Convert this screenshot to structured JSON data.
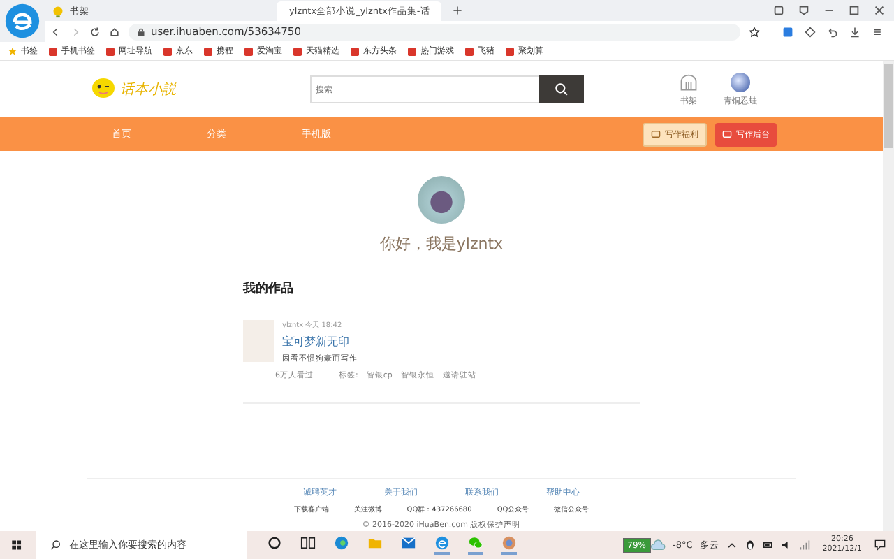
{
  "browser": {
    "tabs": [
      {
        "title": "书架",
        "selected": false
      },
      {
        "title": "ylzntx全部小说_ylzntx作品集-话",
        "selected": true
      }
    ],
    "url": "user.ihuaben.com/53634750",
    "bookmarks": [
      "书签",
      "手机书签",
      "网址导航",
      "京东",
      "携程",
      "爱淘宝",
      "天猫精选",
      "东方头条",
      "热门游戏",
      "飞猪",
      "聚划算"
    ]
  },
  "site": {
    "logo": "话本小説",
    "search": {
      "placeholder": "搜索"
    },
    "header_links": [
      "书架",
      "青铜忍蛙"
    ],
    "nav": [
      "首页",
      "分类",
      "手机版"
    ],
    "nav_buttons": [
      {
        "label": "写作福利",
        "kind": "light"
      },
      {
        "label": "写作后台",
        "kind": "red"
      }
    ]
  },
  "profile": {
    "greeting": "你好，我是ylzntx"
  },
  "works": {
    "title": "我的作品",
    "items": [
      {
        "author": "ylzntx",
        "time": "今天 18:42",
        "title": "宝可梦新无印",
        "intro": "因看不惯狗豪而写作",
        "views": "6万人看过",
        "tags_label": "标签:",
        "tags": [
          "智银cp",
          "智银永恒",
          "邀请驻站"
        ]
      }
    ]
  },
  "footer": {
    "links": [
      "诚聘英才",
      "关于我们",
      "联系我们",
      "帮助中心"
    ],
    "info": [
      "下载客户端",
      "关注微博",
      "QQ群：437266680",
      "QQ公众号",
      "微信公众号"
    ],
    "copyright": "© 2016-2020 iHuaBen.com 版权保护声明"
  },
  "taskbar": {
    "search": {
      "placeholder": "在这里输入你要搜索的内容"
    },
    "battery": "79%",
    "temperature": "-8°C",
    "weather": "多云",
    "time": "20:26",
    "date": "2021/12/1"
  }
}
